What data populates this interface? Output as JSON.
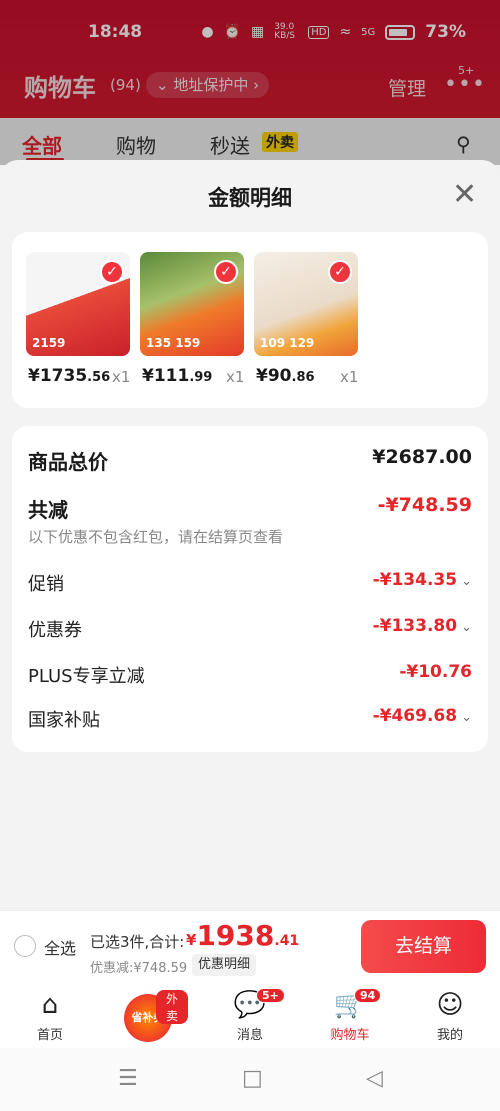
{
  "status_bar": {
    "time": "18:48",
    "net_speed": "39.0 KB/S",
    "hd": "HD",
    "signal": "5G",
    "battery": "73%"
  },
  "header": {
    "title": "购物车",
    "count": "(94)",
    "address_chip": "⌄ 地址保护中 ›",
    "manage": "管理",
    "more_badge": "5+"
  },
  "tabs": [
    {
      "label": "全部"
    },
    {
      "label": "购物"
    },
    {
      "label": "秒送"
    }
  ],
  "tab_flash_badge": "外卖",
  "sheet": {
    "title": "金额明细"
  },
  "products": [
    {
      "price_int": "¥1735",
      "price_dec": ".56",
      "qty": "x1",
      "img_label": "2159",
      "img_color": "#e84a3a"
    },
    {
      "price_int": "¥111",
      "price_dec": ".99",
      "qty": "x1",
      "img_label": "135 159",
      "img_color": "#f07a2a"
    },
    {
      "price_int": "¥90",
      "price_dec": ".86",
      "qty": "x1",
      "img_label": "109 129",
      "img_color": "#eadbc8"
    }
  ],
  "summary": {
    "total_label": "商品总价",
    "total_value": "¥2687.00",
    "reduce_label": "共减",
    "reduce_value": "-¥748.59",
    "reduce_note": "以下优惠不包含红包，请在结算页查看",
    "items": [
      {
        "label": "促销",
        "value": "-¥134.35"
      },
      {
        "label": "优惠券",
        "value": "-¥133.80"
      },
      {
        "label": "PLUS专享立减",
        "value": "-¥10.76"
      },
      {
        "label": "国家补贴",
        "value": "-¥469.68"
      }
    ]
  },
  "checkout": {
    "select_all": "全选",
    "selected_info": "已选3件,合计:",
    "price_cur": "¥",
    "price_int": "1938",
    "price_dec": ".41",
    "discount_line": "优惠减:¥748.59",
    "detail_chip": "优惠明细",
    "button": "去结算"
  },
  "bottom_nav": {
    "home": "首页",
    "promo_tag": "外卖",
    "promo_text": "省补券",
    "msg": "消息",
    "msg_badge": "5+",
    "cart": "购物车",
    "cart_badge": "94",
    "me": "我的"
  },
  "colors": {
    "brand_red": "#e4262a",
    "header_red": "#c8102e"
  }
}
